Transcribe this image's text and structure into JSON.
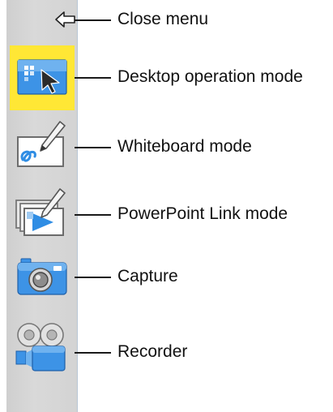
{
  "menu": {
    "close": {
      "icon": "back-arrow-icon",
      "label": "Close menu"
    },
    "items": [
      {
        "key": "desktop",
        "icon": "desktop-cursor-icon",
        "label": "Desktop operation mode",
        "selected": true
      },
      {
        "key": "whiteboard",
        "icon": "whiteboard-pen-icon",
        "label": "Whiteboard mode",
        "selected": false
      },
      {
        "key": "powerpoint",
        "icon": "presentation-play-icon",
        "label": "PowerPoint Link mode",
        "selected": false
      },
      {
        "key": "capture",
        "icon": "camera-icon",
        "label": "Capture",
        "selected": false
      },
      {
        "key": "recorder",
        "icon": "video-camera-icon",
        "label": "Recorder",
        "selected": false
      }
    ]
  },
  "colors": {
    "menu_bg": "#d4d4d4",
    "selected_bg": "#ffe735",
    "icon_blue": "#2f8de4"
  }
}
